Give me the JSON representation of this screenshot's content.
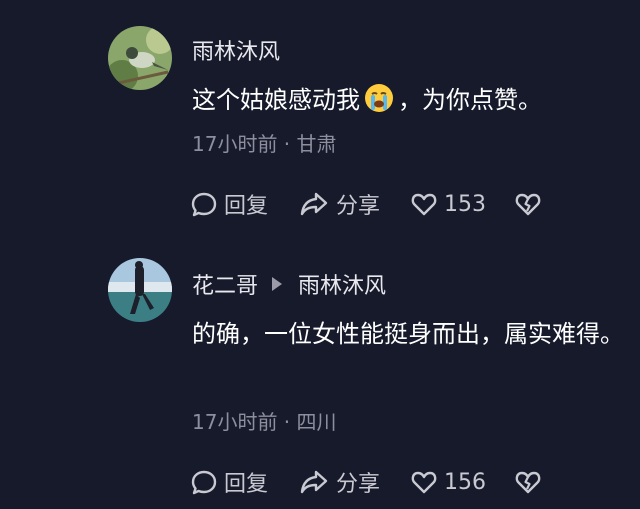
{
  "comments": [
    {
      "username": "雨林沐风",
      "text_before_emoji": "这个姑娘感动我",
      "emoji": "loudly-crying-face",
      "text_after_emoji": "，为你点赞。",
      "meta": "17小时前 · 甘肃",
      "reply_label": "回复",
      "share_label": "分享",
      "like_count": "153"
    },
    {
      "username": "花二哥",
      "reply_to": "雨林沐风",
      "text": "的确，一位女性能挺身而出，属实难得。",
      "meta": "17小时前 · 四川",
      "reply_label": "回复",
      "share_label": "分享",
      "like_count": "156"
    }
  ],
  "colors": {
    "background": "#161a2b",
    "text_primary": "#ffffff",
    "text_meta": "#8d8f9e",
    "action": "#c9c9d2"
  }
}
